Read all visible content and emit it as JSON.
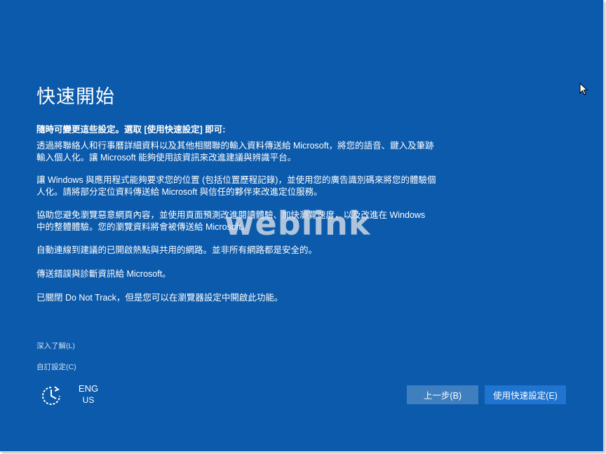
{
  "title": "快速開始",
  "subtitle": "隨時可變更這些設定。選取 [使用快速設定] 即可:",
  "paragraphs": [
    "透過將聯絡人和行事曆詳細資料以及其他相關聯的輸入資料傳送給 Microsoft，將您的語音、鍵入及筆跡輸入個人化。讓 Microsoft 能夠使用該資訊來改進建議與辨識平台。",
    "讓 Windows 與應用程式能夠要求您的位置 (包括位置歷程記錄)，並使用您的廣告識別碼來將您的體驗個人化。請將部分定位資料傳送給 Microsoft 與信任的夥伴來改進定位服務。",
    "協助您避免瀏覽惡意網頁內容，並使用頁面預測改進閱讀體驗、加快瀏覽速度，以及改進在 Windows 中的整體體驗。您的瀏覽資料將會被傳送給 Microsoft。",
    "自動連線到建議的已開啟熱點與共用的網路。並非所有網路都是安全的。",
    "傳送錯誤與診斷資訊給 Microsoft。",
    "已關閉 Do Not Track，但是您可以在瀏覽器設定中開啟此功能。"
  ],
  "links": {
    "learn_more": "深入了解(L)",
    "customize": "自訂設定(C)"
  },
  "language": {
    "code": "ENG",
    "region": "US"
  },
  "buttons": {
    "back": "上一步(B)",
    "express": "使用快速設定(E)"
  },
  "watermark": "weblink",
  "icons": {
    "accessibility": "ease-of-access-icon",
    "cursor": "mouse-pointer-icon"
  },
  "colors": {
    "background": "#0b5aab",
    "back_button": "#3f7fc0",
    "express_button": "#1e74cf",
    "text": "#ffffff"
  }
}
